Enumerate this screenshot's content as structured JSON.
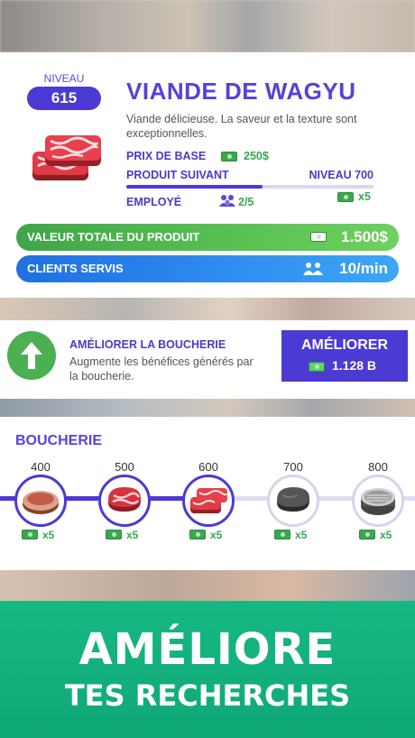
{
  "product": {
    "level_label": "NIVEAU",
    "level": "615",
    "title": "VIANDE DE WAGYU",
    "description": "Viande délicieuse. La saveur et la texture sont exceptionnelles.",
    "base_price_label": "PRIX DE BASE",
    "base_price": "250$",
    "next_product_label": "PRODUIT SUIVANT",
    "next_level": "NIVEAU 700",
    "next_progress": 0.55,
    "next_multiplier": "x5",
    "employee_label": "EMPLOYÉ",
    "employee_count": "2/5",
    "total_value_label": "VALEUR TOTALE DU PRODUIT",
    "total_value": "1.500$",
    "clients_label": "CLIENTS SERVIS",
    "clients_rate": "10/min"
  },
  "upgrade": {
    "title": "AMÉLIORER LA BOUCHERIE",
    "description": "Augmente les bénéfices générés par la boucherie.",
    "button_label": "AMÉLIORER",
    "cost": "1.128 B"
  },
  "shop": {
    "title": "BOUCHERIE",
    "milestones": [
      {
        "level": "400",
        "multiplier": "x5",
        "icon": "steak-icon",
        "unlocked": true
      },
      {
        "level": "500",
        "multiplier": "x5",
        "icon": "raw-steak-icon",
        "unlocked": true
      },
      {
        "level": "600",
        "multiplier": "x5",
        "icon": "wagyu-icon",
        "unlocked": true
      },
      {
        "level": "700",
        "multiplier": "x5",
        "icon": "dark-meat-icon",
        "unlocked": false
      },
      {
        "level": "800",
        "multiplier": "x5",
        "icon": "tin-can-icon",
        "unlocked": false
      }
    ]
  },
  "promo": {
    "line1": "AMÉLIORE",
    "line2": "TES RECHERCHES"
  },
  "colors": {
    "accent": "#4b3ad4",
    "green": "#58c053",
    "blue": "#2f8cf0",
    "promo": "#16b883"
  }
}
